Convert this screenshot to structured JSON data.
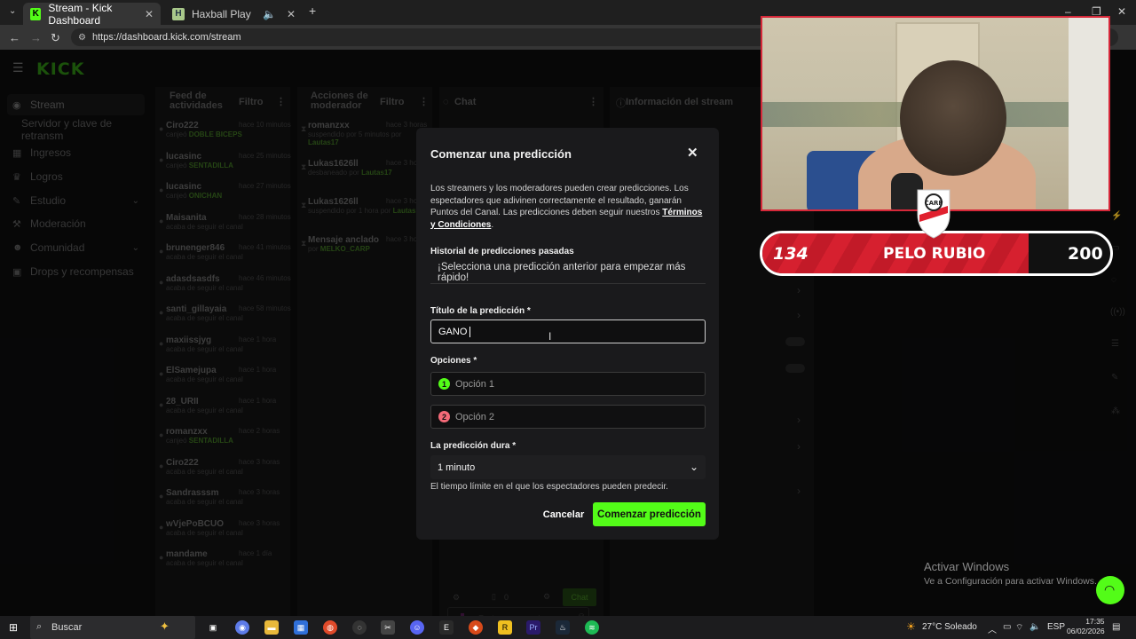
{
  "browser": {
    "tabs": [
      {
        "label": "Stream - Kick Dashboard",
        "active": true
      },
      {
        "label": "Haxball Play",
        "active": false
      }
    ],
    "url": "https://dashboard.kick.com/stream"
  },
  "dashboard": {
    "logo": "KICK",
    "sidebar": [
      {
        "label": "Stream",
        "icon": "stream-icon"
      },
      {
        "label": "Servidor y clave de retransm",
        "icon": ""
      },
      {
        "label": "Ingresos",
        "icon": "money-icon"
      },
      {
        "label": "Logros",
        "icon": "trophy-icon"
      },
      {
        "label": "Estudio",
        "icon": "studio-icon"
      },
      {
        "label": "Moderación",
        "icon": "hammer-icon"
      },
      {
        "label": "Comunidad",
        "icon": "people-icon"
      },
      {
        "label": "Drops y recompensas",
        "icon": "gift-icon"
      }
    ],
    "feed_panel": {
      "title_line1": "Feed de",
      "title_line2": "actividades",
      "filter": "Filtro",
      "rows": [
        {
          "name": "Ciro222",
          "time": "hace 10 minutos",
          "sub": "canjeó ",
          "highlight": "DOBLE BICEPS"
        },
        {
          "name": "lucasinc",
          "time": "hace 25 minutos",
          "sub": "canjeó ",
          "highlight": "SENTADILLA"
        },
        {
          "name": "lucasinc",
          "time": "hace 27 minutos",
          "sub": "canjeó ",
          "highlight": "ONICHAN"
        },
        {
          "name": "Maisanita",
          "time": "hace 28 minutos",
          "sub": "acaba de seguir el canal",
          "highlight": ""
        },
        {
          "name": "brunenger846",
          "time": "hace 41 minutos",
          "sub": "acaba de seguir el canal",
          "highlight": ""
        },
        {
          "name": "adasdsasdfs",
          "time": "hace 46 minutos",
          "sub": "acaba de seguir el canal",
          "highlight": ""
        },
        {
          "name": "santi_gillayaia",
          "time": "hace 58 minutos",
          "sub": "acaba de seguir el canal",
          "highlight": ""
        },
        {
          "name": "maxiissjyg",
          "time": "hace 1 hora",
          "sub": "acaba de seguir el canal",
          "highlight": ""
        },
        {
          "name": "ElSamejupa",
          "time": "hace 1 hora",
          "sub": "acaba de seguir el canal",
          "highlight": ""
        },
        {
          "name": "28_URII",
          "time": "hace 1 hora",
          "sub": "acaba de seguir el canal",
          "highlight": ""
        },
        {
          "name": "romanzxx",
          "time": "hace 2 horas",
          "sub": "canjeó ",
          "highlight": "SENTADILLA"
        },
        {
          "name": "Ciro222",
          "time": "hace 3 horas",
          "sub": "acaba de seguir el canal",
          "highlight": ""
        },
        {
          "name": "Sandrasssm",
          "time": "hace 3 horas",
          "sub": "acaba de seguir el canal",
          "highlight": ""
        },
        {
          "name": "wVjePoBCUO",
          "time": "hace 3 horas",
          "sub": "acaba de seguir el canal",
          "highlight": ""
        },
        {
          "name": "mandame",
          "time": "hace 1 día",
          "sub": "acaba de seguir el canal",
          "highlight": ""
        }
      ]
    },
    "mod_panel": {
      "title_line1": "Acciones de",
      "title_line2": "moderador",
      "filter": "Filtro",
      "rows": [
        {
          "name": "romanzxx",
          "time": "hace 3 horas",
          "sub": "suspendido por 5 minutos por ",
          "highlight": "Lautas17"
        },
        {
          "name": "Lukas1626ll",
          "time": "hace 3 horas",
          "sub": "desbaneado por ",
          "highlight": "Lautas17"
        },
        {
          "name": "Lukas1626ll",
          "time": "hace 3 horas",
          "sub": "suspendido por 1 hora por ",
          "highlight": "Lautas17"
        },
        {
          "name": "Mensaje anclado",
          "time": "hace 3 horas",
          "sub": "por ",
          "highlight": "MELKO_CARP"
        }
      ]
    },
    "chat_panel": {
      "title": "Chat",
      "input_placeholder": "Enviar un mensaje",
      "chat_button": "Chat",
      "count": "0"
    },
    "stream_panel": {
      "title": "Información del stream"
    }
  },
  "modal": {
    "title": "Comenzar una predicción",
    "description": "Los streamers y los moderadores pueden crear predicciones. Los espectadores que adivinen correctamente el resultado, ganarán Puntos del Canal. Las predicciones deben seguir nuestros ",
    "terms_link": "Términos y Condiciones",
    "terms_suffix": ".",
    "history_label": "Historial de predicciones pasadas",
    "history_text": "¡Selecciona una predicción anterior para empezar más rápido!",
    "title_label": "Título de la predicción *",
    "title_value": "GANO",
    "options_label": "Opciones *",
    "option1_placeholder": "Opción 1",
    "option2_placeholder": "Opción 2",
    "duration_label": "La predicción dura *",
    "duration_value": "1 minuto",
    "duration_hint": "El tiempo límite en el que los espectadores pueden predecir.",
    "cancel": "Cancelar",
    "submit": "Comenzar predicción",
    "colors": {
      "option1": "#53fc18",
      "option2": "#f46a78",
      "submit": "#53fc18"
    }
  },
  "overlay": {
    "score_left": "134",
    "score_name": "PELO RUBIO",
    "score_right": "200",
    "crest_text": "CARP"
  },
  "windows": {
    "activate_title": "Activar Windows",
    "activate_sub": "Ve a Configuración para activar Windows.",
    "search": "Buscar",
    "weather": "27°C  Soleado",
    "lang": "ESP",
    "time": "17:35",
    "date": "06/02/2026"
  }
}
